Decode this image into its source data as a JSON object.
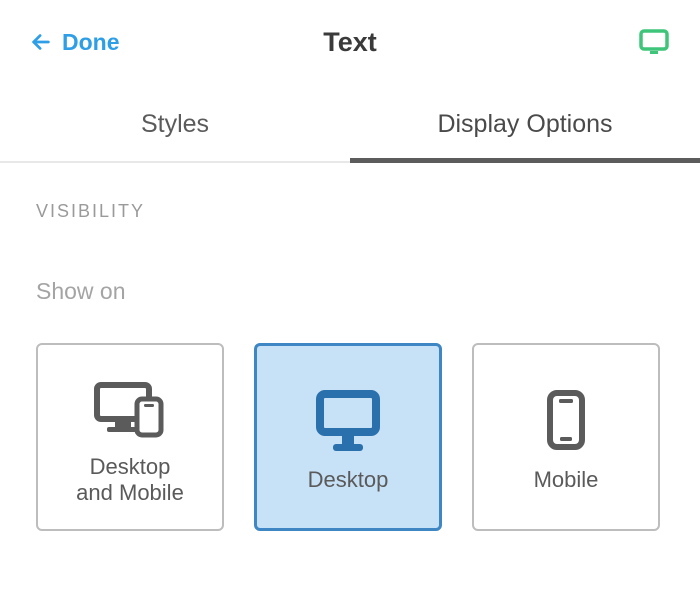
{
  "header": {
    "done_label": "Done",
    "title": "Text"
  },
  "tabs": {
    "styles_label": "Styles",
    "display_options_label": "Display Options",
    "active": "display_options"
  },
  "visibility": {
    "section_label": "VISIBILITY",
    "show_on_label": "Show on",
    "options": [
      {
        "id": "both",
        "label": "Desktop\nand Mobile",
        "selected": false
      },
      {
        "id": "desktop",
        "label": "Desktop",
        "selected": true
      },
      {
        "id": "mobile",
        "label": "Mobile",
        "selected": false
      }
    ]
  },
  "colors": {
    "accent_blue": "#2e9fe6",
    "selected_border": "#3f86c4",
    "selected_bg": "#c7e1f7",
    "device_green": "#3fc57a"
  }
}
